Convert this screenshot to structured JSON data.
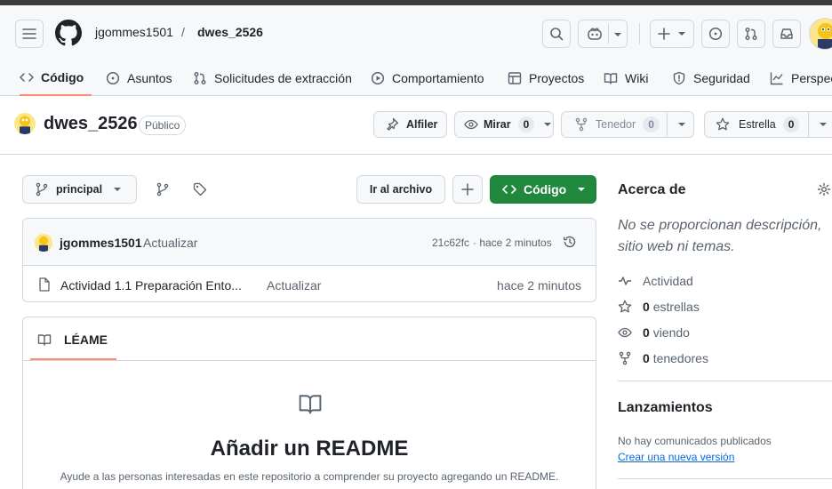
{
  "header": {
    "owner": "jgommes1501",
    "separator": "/",
    "repo": "dwes_2526"
  },
  "nav": {
    "tabs": [
      {
        "label": "Código",
        "icon": "code-icon"
      },
      {
        "label": "Asuntos",
        "icon": "issue-icon"
      },
      {
        "label": "Solicitudes de extracción",
        "icon": "pull-request-icon"
      },
      {
        "label": "Comportamiento",
        "icon": "play-icon"
      },
      {
        "label": "Proyectos",
        "icon": "table-icon"
      },
      {
        "label": "Wiki",
        "icon": "book-icon"
      },
      {
        "label": "Seguridad",
        "icon": "shield-icon"
      },
      {
        "label": "Perspec",
        "icon": "graph-icon"
      }
    ]
  },
  "repo": {
    "name": "dwes_2526",
    "visibility": "Público",
    "pin_label": "Alfiler",
    "watch_label": "Mirar",
    "watch_count": "0",
    "fork_label": "Tenedor",
    "fork_count": "0",
    "star_label": "Estrella",
    "star_count": "0"
  },
  "toolbar": {
    "branch": "principal",
    "goto_file": "Ir al archivo",
    "code_button": "Código"
  },
  "commit": {
    "author": "jgommes1501",
    "message": "Actualizar",
    "sha": "21c62fc",
    "time": "· hace 2 minutos"
  },
  "files": [
    {
      "name": "Actividad 1.1 Preparación Ento...",
      "message": "Actualizar",
      "time": "hace 2 minutos"
    }
  ],
  "readme": {
    "tab_label": "LÉAME",
    "title": "Añadir un README",
    "description": "Ayude a las personas interesadas en este repositorio a comprender su proyecto agregando un README."
  },
  "about": {
    "title": "Acerca de",
    "description": "No se proporcionan descripción, sitio web ni temas.",
    "activity": "Actividad",
    "stars_count": "0",
    "stars_label": "estrellas",
    "watching_count": "0",
    "watching_label": "viendo",
    "forks_count": "0",
    "forks_label": "tenedores"
  },
  "releases": {
    "title": "Lanzamientos",
    "none": "No hay comunicados publicados",
    "create_link": "Crear una nueva versión"
  },
  "colors": {
    "accent_green": "#1f883d",
    "tab_underline": "#fd8c73",
    "link": "#0969da"
  }
}
